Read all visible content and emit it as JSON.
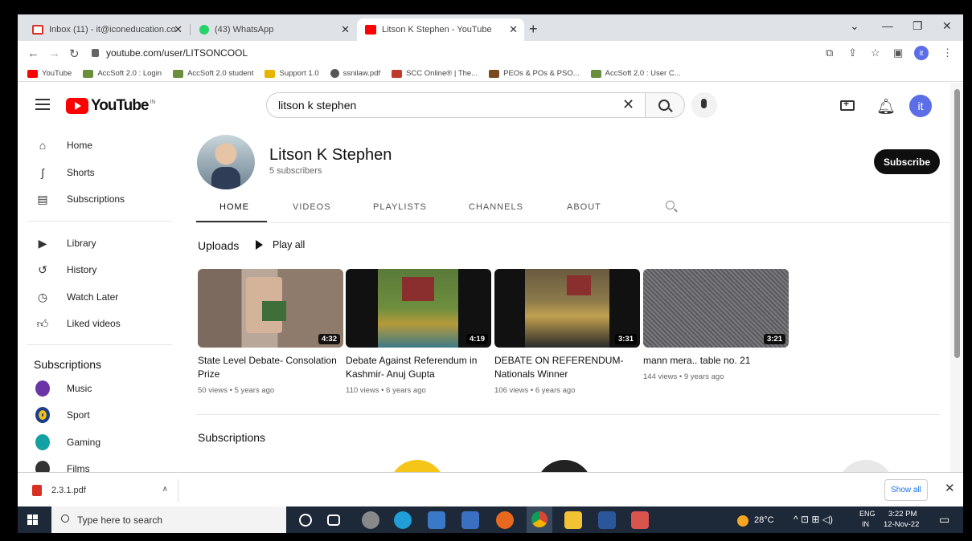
{
  "browser": {
    "tabs": [
      {
        "label": "Inbox (11) - it@iconeducation.co",
        "close": "✕"
      },
      {
        "label": "(43) WhatsApp",
        "close": "✕"
      },
      {
        "label": "Litson K Stephen - YouTube",
        "close": "✕"
      }
    ],
    "new_tab": "+",
    "url": "youtube.com/user/LITSONCOOL",
    "profile_initial": "it",
    "bookmarks": [
      "YouTube",
      "AccSoft 2.0 : Login",
      "AccSoft 2.0 student",
      "Support 1.0",
      "ssnilaw.pdf",
      "SCC Online® | The...",
      "PEOs & POs & PSO...",
      "AccSoft 2.0 : User C..."
    ]
  },
  "youtube": {
    "logo_text": "YouTube",
    "logo_country": "IN",
    "search_value": "litson k stephen",
    "avatar_initial": "it"
  },
  "sidebar": {
    "items": [
      "Home",
      "Shorts",
      "Subscriptions",
      "Library",
      "History",
      "Watch Later",
      "Liked videos"
    ],
    "subs_heading": "Subscriptions",
    "subs": [
      "Music",
      "Sport",
      "Gaming",
      "Films"
    ]
  },
  "channel": {
    "name": "Litson K Stephen",
    "subscribers": "5 subscribers",
    "subscribe_label": "Subscribe",
    "tabs": [
      "HOME",
      "VIDEOS",
      "PLAYLISTS",
      "CHANNELS",
      "ABOUT"
    ],
    "uploads_title": "Uploads",
    "play_all": "Play all",
    "subscriptions_title": "Subscriptions"
  },
  "videos": [
    {
      "title": "State Level Debate- Consolation Prize",
      "meta": "50 views • 5 years ago",
      "duration": "4:32"
    },
    {
      "title": "Debate Against Referendum in Kashmir- Anuj Gupta",
      "meta": "110 views • 6 years ago",
      "duration": "4:19"
    },
    {
      "title": "DEBATE ON REFERENDUM- Nationals Winner",
      "meta": "106 views • 6 years ago",
      "duration": "3:31"
    },
    {
      "title": "mann mera.. table no. 21",
      "meta": "144 views • 9 years ago",
      "duration": "3:21"
    }
  ],
  "downloads": {
    "file": "2.3.1.pdf",
    "show_all": "Show all"
  },
  "taskbar": {
    "search_placeholder": "Type here to search",
    "temperature": "28°C",
    "lang": "ENG",
    "region": "IN",
    "time": "3:22 PM",
    "date": "12-Nov-22"
  }
}
